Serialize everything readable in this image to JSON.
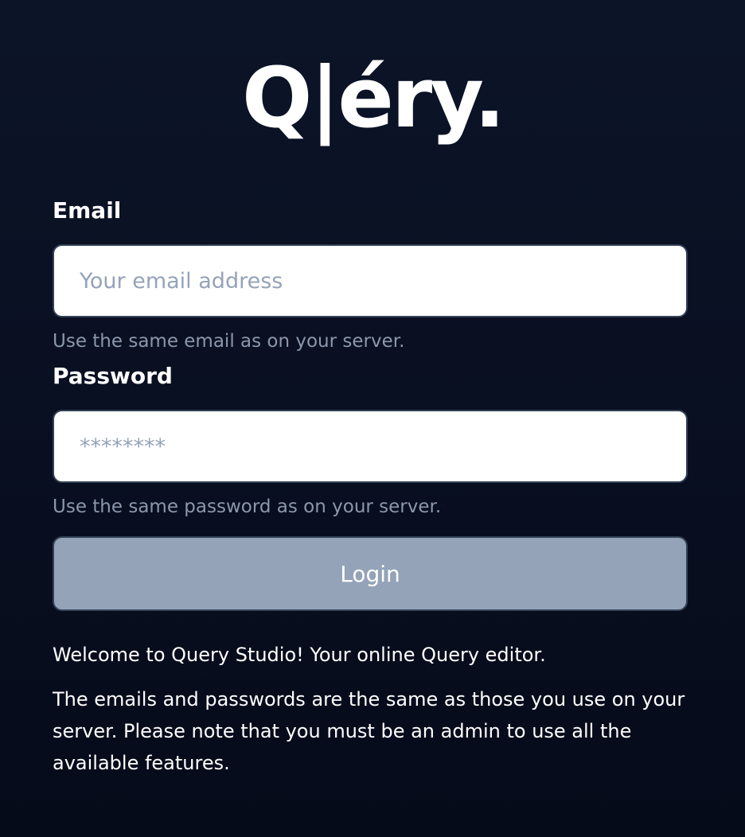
{
  "brand": {
    "logo_text": "Q|éry."
  },
  "form": {
    "email": {
      "label": "Email",
      "placeholder": "Your email address",
      "value": "",
      "hint": "Use the same email as on your server."
    },
    "password": {
      "label": "Password",
      "placeholder": "********",
      "value": "",
      "hint": "Use the same password as on your server."
    },
    "login_label": "Login"
  },
  "info": {
    "welcome": "Welcome to Query Studio! Your online Query editor.",
    "note": "The emails and passwords are the same as those you use on your server. Please note that you must be an admin to use all the available features."
  },
  "colors": {
    "background": "#0a1224",
    "button_disabled": "#94a3b8",
    "hint_text": "#8b97ab"
  }
}
